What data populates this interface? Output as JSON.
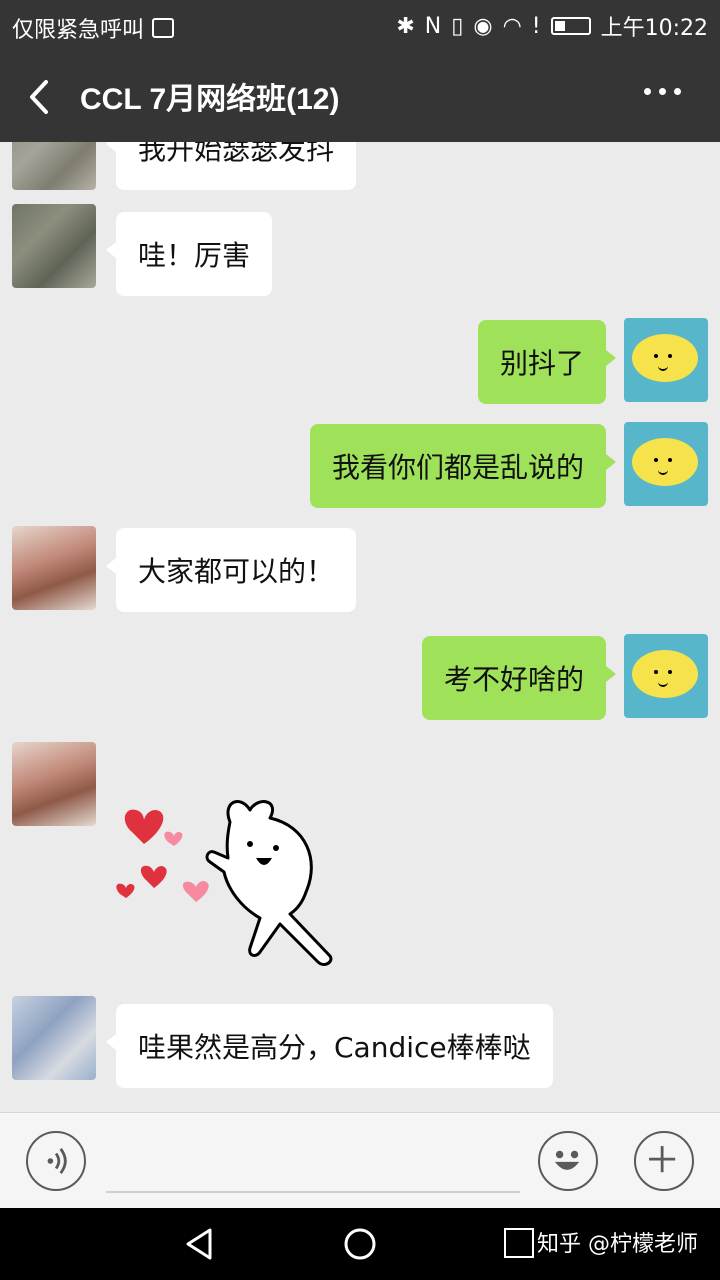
{
  "status_bar": {
    "left_text": "仅限紧急呼叫",
    "time": "上午10:22"
  },
  "header": {
    "title": "CCL 7月网络班(12)"
  },
  "messages": [
    {
      "side": "in",
      "text": "我开始瑟瑟发抖"
    },
    {
      "side": "in",
      "text": "哇！厉害"
    },
    {
      "side": "out",
      "text": "别抖了"
    },
    {
      "side": "out",
      "text": "我看你们都是乱说的"
    },
    {
      "side": "in",
      "text": "大家都可以的！"
    },
    {
      "side": "out",
      "text": "考不好啥的"
    },
    {
      "side": "in",
      "text": "哇果然是高分，Candice棒棒哒"
    }
  ],
  "sticker": {
    "icon": "bunny-hearts-sticker"
  },
  "colors": {
    "header_bg": "#353535",
    "chat_bg": "#ebebeb",
    "incoming_bubble": "#ffffff",
    "outgoing_bubble": "#9fe25a"
  },
  "watermark": {
    "text": "知乎 @柠檬老师"
  }
}
